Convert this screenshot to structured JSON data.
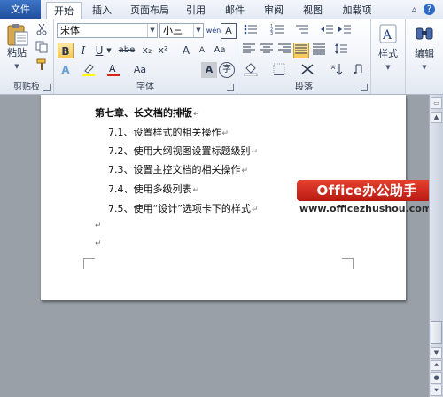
{
  "tabs": [
    {
      "label": "文件"
    },
    {
      "label": "开始"
    },
    {
      "label": "插入"
    },
    {
      "label": "页面布局"
    },
    {
      "label": "引用"
    },
    {
      "label": "邮件"
    },
    {
      "label": "审阅"
    },
    {
      "label": "视图"
    },
    {
      "label": "加载项"
    }
  ],
  "window_controls": {
    "minimize": "▵",
    "help": "?"
  },
  "ribbon": {
    "clipboard": {
      "label": "剪贴板",
      "paste": "粘贴",
      "cut_icon": "scissors-icon",
      "copy_icon": "copy-icon",
      "format_painter_icon": "brush-icon"
    },
    "font": {
      "label": "字体",
      "font_name": "宋体",
      "font_size": "小三",
      "phonetic": "wén",
      "border_char": "A",
      "bold": "B",
      "italic": "I",
      "underline": "U",
      "strike": "abe",
      "sub": "x₂",
      "sup": "x²",
      "grow": "A",
      "shrink": "A",
      "case": "Aa",
      "clear": "A",
      "char_shade": "A",
      "enclose": "字"
    },
    "paragraph": {
      "label": "段落"
    },
    "styles": {
      "label": "样式"
    },
    "editing": {
      "label": "编辑"
    }
  },
  "document": {
    "heading": "第七章、长文档的排版",
    "items": [
      "7.1、设置样式的相关操作",
      "7.2、使用大纲视图设置标题级别",
      "7.3、设置主控文档的相关操作",
      "7.4、使用多级列表",
      "7.5、使用“设计”选项卡下的样式"
    ],
    "pmark": "↵"
  },
  "watermark": {
    "brand": "Office办公助手",
    "url": "www.officezhushou.com"
  },
  "colors": {
    "file_tab": "#2a5db0",
    "highlight": "#ffff00",
    "font_color": "#e02020",
    "watermark": "#d32b1e"
  }
}
